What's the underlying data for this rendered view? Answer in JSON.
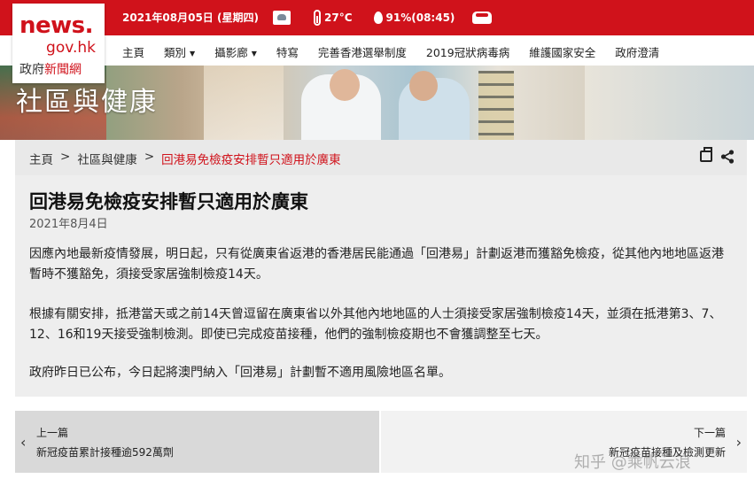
{
  "brand": {
    "logo_line1": "news.",
    "logo_line2": "gov.hk",
    "logo_line3_a": "政府",
    "logo_line3_b": "新聞網"
  },
  "topbar": {
    "date": "2021年08月05日 (星期四)",
    "temperature": "27°C",
    "humidity": "91%(08:45)",
    "icons": [
      "weather-icon",
      "thermometer-icon",
      "droplet-icon",
      "car-icon"
    ]
  },
  "nav": {
    "items": [
      {
        "label": "主頁"
      },
      {
        "label": "類別",
        "dropdown": true
      },
      {
        "label": "攝影廊",
        "dropdown": true
      },
      {
        "label": "特寫"
      },
      {
        "label": "完善香港選舉制度"
      },
      {
        "label": "2019冠狀病毒病"
      },
      {
        "label": "維護國家安全"
      },
      {
        "label": "政府澄清"
      }
    ]
  },
  "banner": {
    "title": "社區與健康"
  },
  "breadcrumb": {
    "home": "主頁",
    "section": "社區與健康",
    "current": "回港易免檢疫安排暫只適用於廣東",
    "separator": ">"
  },
  "article": {
    "title": "回港易免檢疫安排暫只適用於廣東",
    "date": "2021年8月4日",
    "paragraphs": [
      "因應內地最新疫情發展，明日起，只有從廣東省返港的香港居民能通過「回港易」計劃返港而獲豁免檢疫，從其他內地地區返港暫時不獲豁免，須接受家居強制檢疫14天。",
      "根據有關安排，抵港當天或之前14天曾逗留在廣東省以外其他內地地區的人士須接受家居強制檢疫14天，並須在抵港第3、7、12、16和19天接受強制檢測。即使已完成疫苗接種，他們的強制檢疫期也不會獲調整至七天。",
      "政府昨日已公布，今日起將澳門納入「回港易」計劃暫不適用風險地區名單。"
    ]
  },
  "pager": {
    "prev_label": "上一篇",
    "prev_title": "新冠疫苗累計接種逾592萬劑",
    "next_label": "下一篇",
    "next_title": "新冠疫苗接種及檢測更新"
  },
  "watermark": "知乎 @乘帆云浪",
  "colors": {
    "brand_red": "#d0121b",
    "article_bg": "#eeeeee",
    "crumb_bg": "#e9e9e9"
  }
}
